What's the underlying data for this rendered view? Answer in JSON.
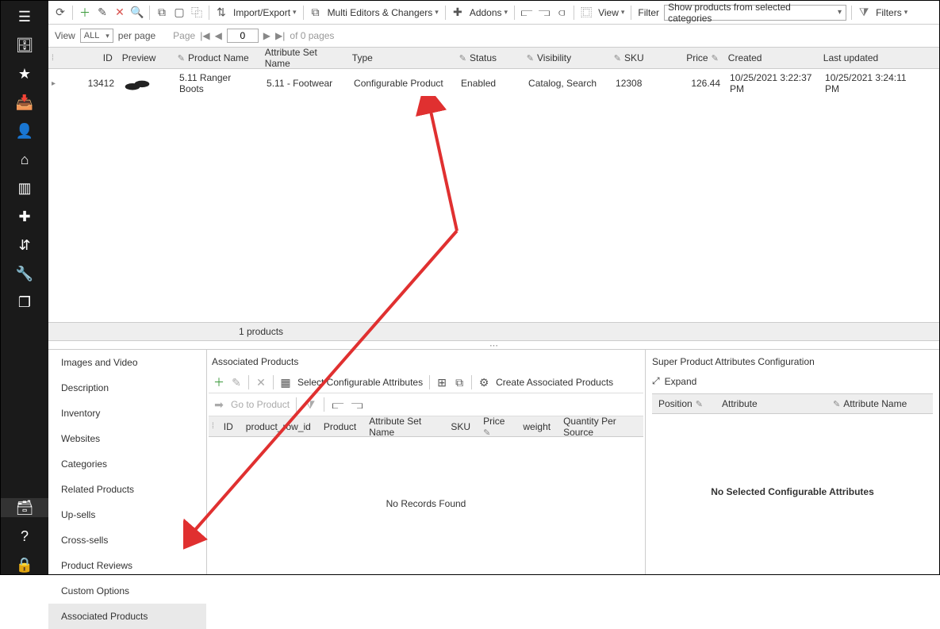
{
  "sidebar": {
    "items": [
      {
        "name": "menu"
      },
      {
        "name": "archive"
      },
      {
        "name": "star"
      },
      {
        "name": "inbox"
      },
      {
        "name": "user"
      },
      {
        "name": "home"
      },
      {
        "name": "chart"
      },
      {
        "name": "puzzle"
      },
      {
        "name": "sort"
      },
      {
        "name": "wrench"
      },
      {
        "name": "copy"
      }
    ],
    "bottom_items": [
      {
        "name": "box"
      },
      {
        "name": "help"
      },
      {
        "name": "lock"
      }
    ]
  },
  "toolbar": {
    "import_export": "Import/Export",
    "multi_editors": "Multi Editors & Changers",
    "addons": "Addons",
    "view": "View",
    "filter_label": "Filter",
    "filter_value": "Show products from selected categories",
    "filters_label": "Filters"
  },
  "paging": {
    "view_label": "View",
    "view_value": "ALL",
    "per_page_label": "per page",
    "page_label": "Page",
    "page_input": "0",
    "of_pages": "of 0 pages"
  },
  "grid": {
    "columns": {
      "id": "ID",
      "preview": "Preview",
      "product_name": "Product Name",
      "attribute_set": "Attribute Set Name",
      "type": "Type",
      "status": "Status",
      "visibility": "Visibility",
      "sku": "SKU",
      "price": "Price",
      "created": "Created",
      "updated": "Last updated"
    },
    "row": {
      "id": "13412",
      "product_name": "5.11 Ranger Boots",
      "attribute_set": "5.11 - Footwear",
      "type": "Configurable Product",
      "status": "Enabled",
      "visibility": "Catalog, Search",
      "sku": "12308",
      "price": "126.44",
      "created": "10/25/2021 3:22:37 PM",
      "updated": "10/25/2021 3:24:11 PM"
    },
    "summary": "1 products"
  },
  "tabs": {
    "items": [
      "Images and Video",
      "Description",
      "Inventory",
      "Websites",
      "Categories",
      "Related Products",
      "Up-sells",
      "Cross-sells",
      "Product Reviews",
      "Custom Options",
      "Associated Products"
    ],
    "active_index": 10
  },
  "assoc": {
    "title": "Associated Products",
    "select_attrs": "Select Configurable Attributes",
    "create_products": "Create Associated Products",
    "go_to_product": "Go to Product",
    "columns": [
      "ID",
      "product_row_id",
      "Product",
      "Attribute Set Name",
      "SKU",
      "Price",
      "weight",
      "Quantity Per Source"
    ],
    "no_records": "No Records Found"
  },
  "super": {
    "title": "Super Product Attributes Configuration",
    "expand": "Expand",
    "columns": {
      "position": "Position",
      "attribute": "Attribute",
      "attr_name": "Attribute Name"
    },
    "empty": "No Selected Configurable Attributes"
  }
}
